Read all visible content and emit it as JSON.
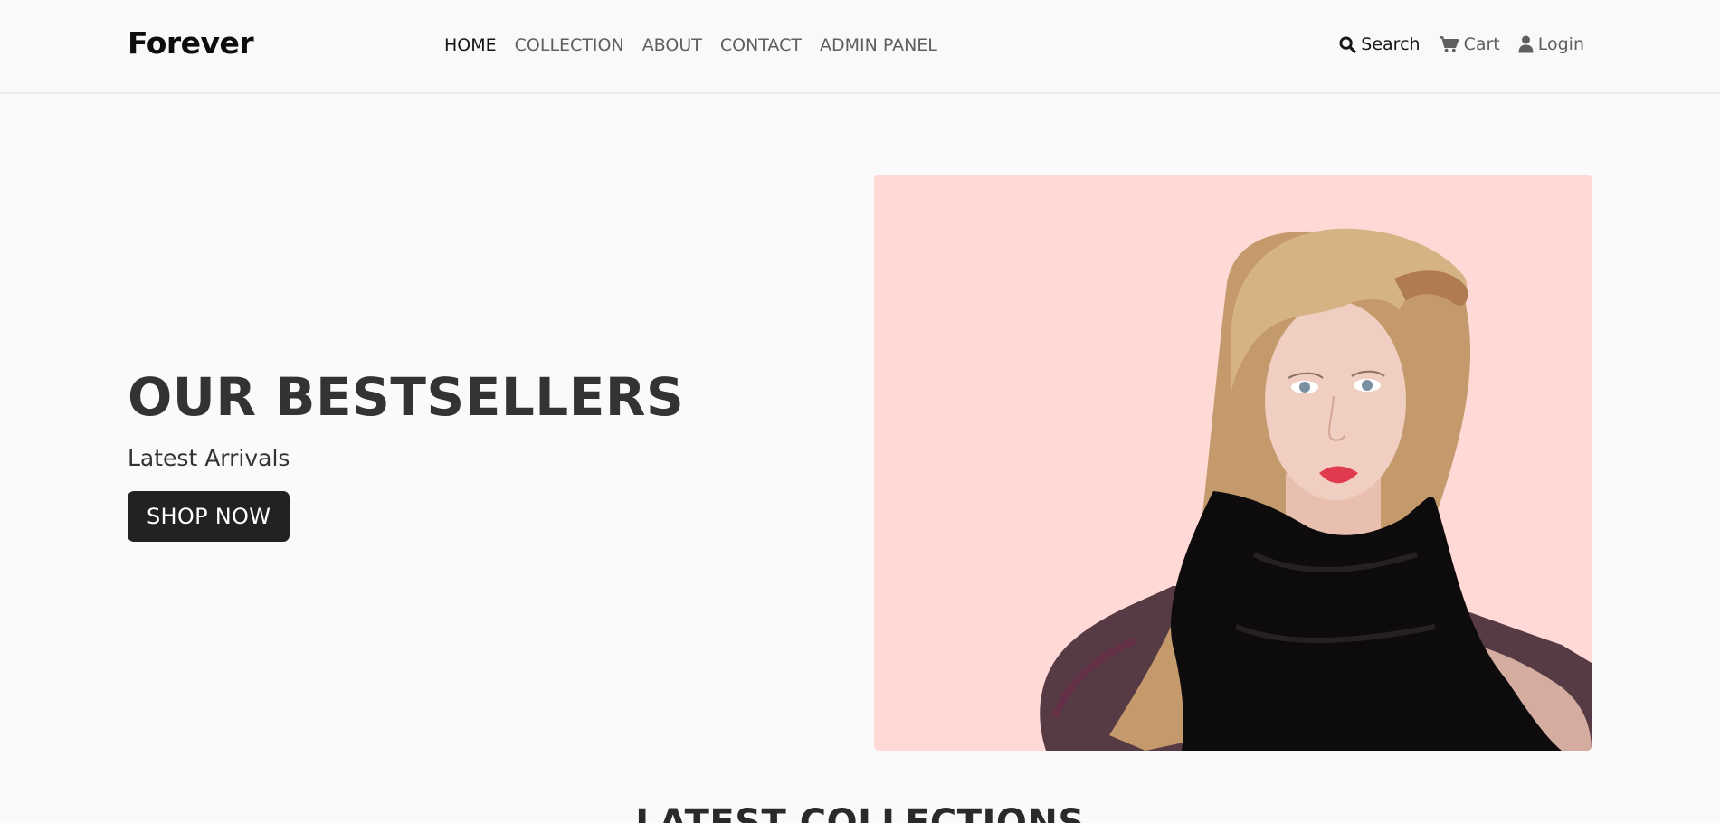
{
  "brand": {
    "name": "Forever"
  },
  "nav": {
    "links": [
      {
        "label": "HOME",
        "active": true
      },
      {
        "label": "COLLECTION",
        "active": false
      },
      {
        "label": "ABOUT",
        "active": false
      },
      {
        "label": "CONTACT",
        "active": false
      },
      {
        "label": "ADMIN PANEL",
        "active": false
      }
    ],
    "search_label": "Search",
    "cart_label": "Cart",
    "login_label": "Login"
  },
  "hero": {
    "title": "OUR BESTSELLERS",
    "subtitle": "Latest Arrivals",
    "cta_label": "SHOP NOW",
    "image_bg_color": "#ffd9d6"
  },
  "section": {
    "title": "LATEST COLLECTIONS"
  },
  "icons": {
    "search": "search-icon",
    "cart": "cart-icon",
    "login": "user-icon"
  },
  "colors": {
    "navbar_bg": "#f8f9fa",
    "page_bg": "#fafafa",
    "button_bg": "#222222",
    "heading": "#333333"
  }
}
